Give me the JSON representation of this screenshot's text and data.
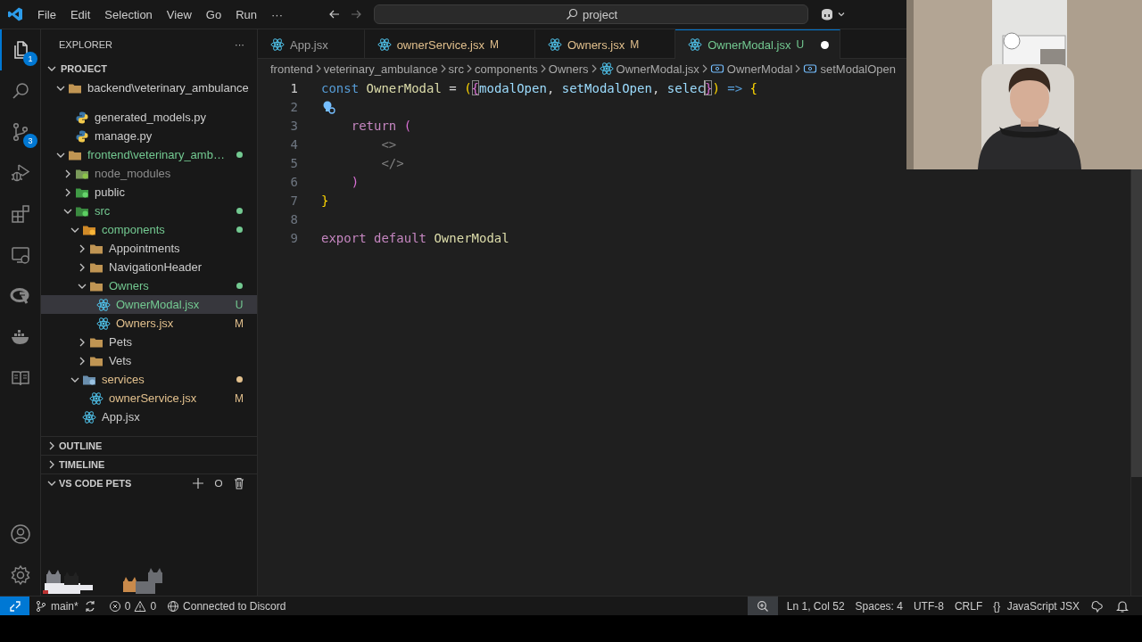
{
  "title_bar": {
    "menu": [
      "File",
      "Edit",
      "Selection",
      "View",
      "Go",
      "Run",
      "···"
    ],
    "search": "project"
  },
  "activity_bar": {
    "items": [
      {
        "kind": "explorer",
        "selected": true,
        "badge": "1"
      },
      {
        "kind": "search",
        "selected": false
      },
      {
        "kind": "source-control",
        "selected": false,
        "badge": "3"
      },
      {
        "kind": "run-debug",
        "selected": false
      },
      {
        "kind": "extensions",
        "selected": false
      },
      {
        "kind": "remote",
        "selected": false
      },
      {
        "kind": "r",
        "selected": false
      },
      {
        "kind": "docker",
        "selected": false
      },
      {
        "kind": "book",
        "selected": false
      }
    ],
    "bottom": [
      {
        "kind": "account"
      },
      {
        "kind": "settings"
      }
    ]
  },
  "sidebar": {
    "title": "EXPLORER",
    "more": "···",
    "section": "PROJECT",
    "tree": [
      {
        "label": "backend\\veterinary_ambulance",
        "kind": "folder",
        "expanded": true,
        "selected": false,
        "children": [
          {
            "label": "generated_models.py",
            "kind": "python",
            "selected": false
          },
          {
            "label": "manage.py",
            "kind": "python",
            "selected": false
          }
        ]
      },
      {
        "label": "frontend\\veterinary_amb…",
        "kind": "folder",
        "expanded": true,
        "selected": false,
        "color": "#73c991",
        "dot": true,
        "children": [
          {
            "label": "node_modules",
            "kind": "folder-node",
            "expanded": false,
            "selected": false,
            "color": "#8c8c8c"
          },
          {
            "label": "public",
            "kind": "folder-public",
            "expanded": false,
            "selected": false
          },
          {
            "label": "src",
            "kind": "folder-src",
            "expanded": true,
            "selected": false,
            "color": "#73c991",
            "dot": true,
            "children": [
              {
                "label": "components",
                "kind": "folder-components",
                "expanded": true,
                "selected": false,
                "color": "#73c991",
                "dot": true,
                "children": [
                  {
                    "label": "Appointments",
                    "kind": "folder",
                    "expanded": false,
                    "selected": false
                  },
                  {
                    "label": "NavigationHeader",
                    "kind": "folder",
                    "expanded": false,
                    "selected": false
                  },
                  {
                    "label": "Owners",
                    "kind": "folder",
                    "expanded": true,
                    "selected": false,
                    "color": "#73c991",
                    "dot": true,
                    "children": [
                      {
                        "label": "OwnerModal.jsx",
                        "kind": "react",
                        "selected": true,
                        "color": "#73c991",
                        "badge": "U"
                      },
                      {
                        "label": "Owners.jsx",
                        "kind": "react",
                        "selected": false,
                        "color": "#e2c08d",
                        "badge": "M"
                      }
                    ]
                  },
                  {
                    "label": "Pets",
                    "kind": "folder",
                    "expanded": false,
                    "selected": false
                  },
                  {
                    "label": "Vets",
                    "kind": "folder",
                    "expanded": false,
                    "selected": false
                  }
                ]
              },
              {
                "label": "services",
                "kind": "folder-services",
                "expanded": true,
                "selected": false,
                "color": "#e2c08d",
                "dot": true,
                "children": [
                  {
                    "label": "ownerService.jsx",
                    "kind": "react",
                    "selected": false,
                    "color": "#e2c08d",
                    "badge": "M"
                  }
                ]
              },
              {
                "label": "App.jsx",
                "kind": "react",
                "selected": false
              }
            ]
          }
        ]
      }
    ],
    "panels": [
      {
        "title": "OUTLINE",
        "expanded": false
      },
      {
        "title": "TIMELINE",
        "expanded": false
      },
      {
        "title": "VS CODE PETS",
        "expanded": true
      }
    ]
  },
  "editor": {
    "tabs": [
      {
        "label": "App.jsx",
        "selected": false,
        "dirty": false
      },
      {
        "label": "ownerService.jsx",
        "badge": "M",
        "color": "#e2c08d",
        "selected": false,
        "dirty": false
      },
      {
        "label": "Owners.jsx",
        "badge": "M",
        "color": "#e2c08d",
        "selected": false,
        "dirty": false
      },
      {
        "label": "OwnerModal.jsx",
        "badge": "U",
        "color": "#73c991",
        "selected": true,
        "dirty": true
      }
    ],
    "breadcrumbs": [
      {
        "label": "frontend",
        "kind": "folder"
      },
      {
        "label": "veterinary_ambulance",
        "kind": "folder"
      },
      {
        "label": "src",
        "kind": "folder"
      },
      {
        "label": "components",
        "kind": "folder"
      },
      {
        "label": "Owners",
        "kind": "folder"
      },
      {
        "label": "OwnerModal.jsx",
        "kind": "react"
      },
      {
        "label": "OwnerModal",
        "kind": "symbol"
      },
      {
        "label": "setModalOpen",
        "kind": "symbol"
      }
    ],
    "lines": [
      {
        "number": "1",
        "active": true,
        "tokens": [
          {
            "text": "const ",
            "kind": "keyword"
          },
          {
            "text": "OwnerModal",
            "kind": "function"
          },
          {
            "text": " = ",
            "kind": "text"
          },
          {
            "text": "(",
            "kind": "bracket1"
          },
          {
            "text": "{",
            "kind": "bracket2",
            "match": true
          },
          {
            "text": "modalOpen",
            "kind": "param"
          },
          {
            "text": ", ",
            "kind": "text"
          },
          {
            "text": "setModalOpen",
            "kind": "param"
          },
          {
            "text": ", ",
            "kind": "text"
          },
          {
            "text": "selec",
            "kind": "param"
          },
          {
            "text": "}",
            "kind": "bracket2",
            "match": true,
            "cursor_before": true
          },
          {
            "text": ")",
            "kind": "bracket1"
          },
          {
            "text": " => ",
            "kind": "keyword"
          },
          {
            "text": "{",
            "kind": "bracket1"
          }
        ]
      },
      {
        "number": "2",
        "active": false,
        "lightbulb": true
      },
      {
        "number": "3",
        "active": false,
        "tokens": [
          {
            "text": "    return ",
            "kind": "control"
          },
          {
            "text": "(",
            "kind": "bracket2"
          }
        ]
      },
      {
        "number": "4",
        "active": false,
        "tokens": [
          {
            "text": "        <>",
            "kind": "tag"
          }
        ]
      },
      {
        "number": "5",
        "active": false,
        "tokens": [
          {
            "text": "        </>",
            "kind": "tag"
          }
        ]
      },
      {
        "number": "6",
        "active": false,
        "tokens": [
          {
            "text": "    )",
            "kind": "bracket2"
          }
        ]
      },
      {
        "number": "7",
        "active": false,
        "tokens": [
          {
            "text": "}",
            "kind": "bracket1"
          }
        ]
      },
      {
        "number": "8",
        "active": false
      },
      {
        "number": "9",
        "active": false,
        "tokens": [
          {
            "text": "export default ",
            "kind": "control"
          },
          {
            "text": "OwnerModal",
            "kind": "function"
          }
        ]
      }
    ]
  },
  "status_bar": {
    "branch": "main*",
    "errors": "0",
    "warnings": "0",
    "discord": "Connected to Discord",
    "position": "Ln 1, Col 52",
    "indent": "Spaces: 4",
    "encoding": "UTF-8",
    "eol": "CRLF",
    "language_icon": "{}",
    "language": "JavaScript JSX"
  }
}
